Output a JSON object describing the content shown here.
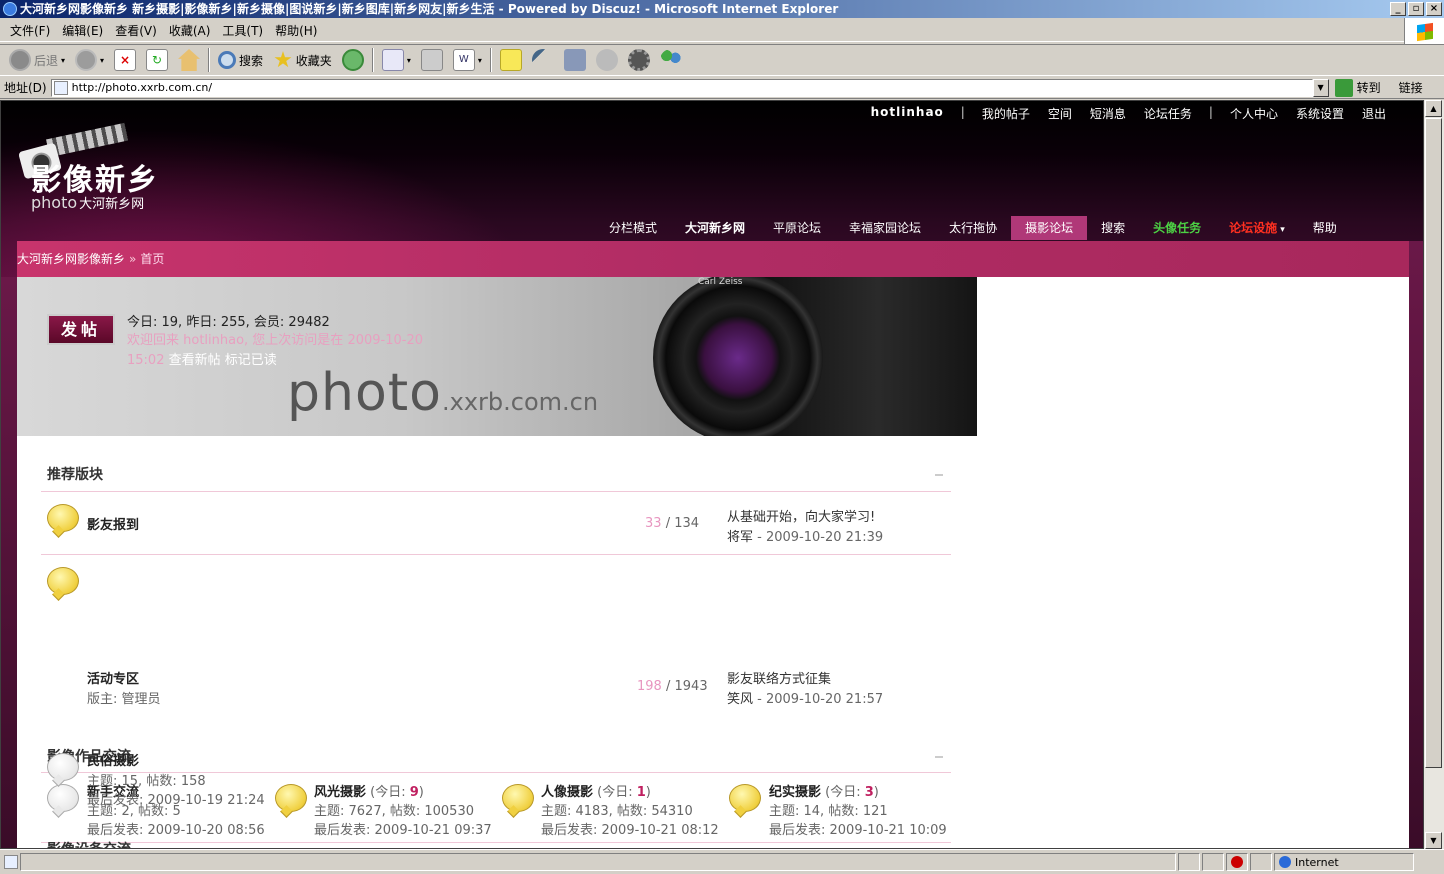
{
  "window": {
    "title": "大河新乡网影像新乡 新乡摄影|影像新乡|新乡摄像|图说新乡|新乡图库|新乡网友|新乡生活 - Powered by Discuz! - Microsoft Internet Explorer",
    "min": "_",
    "max": "▫",
    "close": "×"
  },
  "menu": [
    "文件(F)",
    "编辑(E)",
    "查看(V)",
    "收藏(A)",
    "工具(T)",
    "帮助(H)"
  ],
  "toolbar": {
    "back": "后退",
    "search": "搜索",
    "favorites": "收藏夹"
  },
  "address": {
    "label": "地址(D)",
    "url": "http://photo.xxrb.com.cn/",
    "go": "转到",
    "links": "链接"
  },
  "status": {
    "zone": "Internet"
  },
  "site": {
    "logo_main": "影像新乡",
    "logo_sub": "photo",
    "logo_sub2": "大河新乡网",
    "top_links": {
      "user": "hotlinhao",
      "sep": "|",
      "items": [
        "我的帖子",
        "空间",
        "短消息",
        "论坛任务"
      ],
      "items2": [
        "个人中心",
        "系统设置",
        "退出"
      ]
    },
    "nav": [
      "分栏模式",
      "大河新乡网",
      "平原论坛",
      "幸福家园论坛",
      "太行拖协",
      "摄影论坛",
      "搜索",
      "头像任务",
      "论坛设施",
      "帮助"
    ],
    "breadcrumb": {
      "home": "大河新乡网影像新乡",
      "sep": "»",
      "current": "首页"
    },
    "banner": {
      "post_button": "发帖",
      "stats": "今日: 19, 昨日: 255, 会员: 29482",
      "welcome": "欢迎回来 hotlinhao, 您上次访问是在 2009-10-20 15:02",
      "view_new": "查看新帖",
      "mark_read": "标记已读",
      "photo_text": "photo",
      "photo_domain": ".xxrb.com.cn",
      "lens_label": "Carl Zeiss"
    },
    "recommended": {
      "title": "推荐版块",
      "forums": [
        {
          "name": "影友报到",
          "topics": "33",
          "posts": "134",
          "slash": "/",
          "last_title": "从基础开始，向大家学习!",
          "last_author": "将军",
          "last_time": "- 2009-10-20 21:39"
        },
        {
          "name": "活动专区",
          "moderator": "版主: 管理员",
          "topics": "198",
          "posts": "1943",
          "slash": "/",
          "last_title": "影友联络方式征集",
          "last_author": "笑风",
          "last_time": "- 2009-10-20 21:57"
        }
      ]
    },
    "works": {
      "title": "影像作品交流",
      "forums": [
        {
          "name": "新手交流",
          "today": "",
          "stats": "主题: 2, 帖数: 5",
          "last": "最后发表: 2009-10-20 08:56"
        },
        {
          "name": "风光摄影",
          "today_prefix": "(今日: ",
          "today": "9",
          "today_suffix": ")",
          "stats": "主题: 7627, 帖数: 100530",
          "last": "最后发表: 2009-10-21 09:37"
        },
        {
          "name": "人像摄影",
          "today_prefix": "(今日: ",
          "today": "1",
          "today_suffix": ")",
          "stats": "主题: 4183, 帖数: 54310",
          "last": "最后发表: 2009-10-21 08:12"
        },
        {
          "name": "纪实摄影",
          "today_prefix": "(今日: ",
          "today": "3",
          "today_suffix": ")",
          "stats": "主题: 14, 帖数: 121",
          "last": "最后发表: 2009-10-21 10:09"
        },
        {
          "name": "民俗摄影",
          "today": "",
          "stats": "主题: 15, 帖数: 158",
          "last": "最后发表: 2009-10-19 21:24"
        }
      ]
    },
    "next_section": "影像设备交流"
  }
}
